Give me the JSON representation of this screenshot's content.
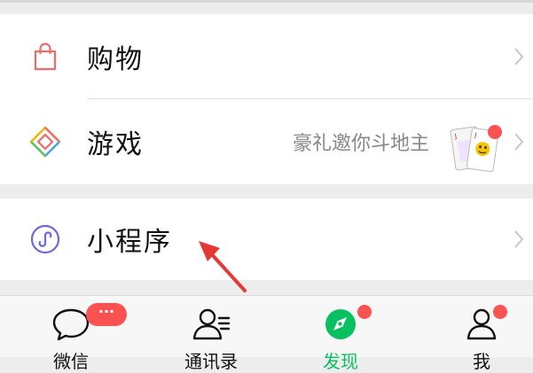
{
  "discover_list": {
    "shopping": {
      "label": "购物",
      "icon": "shopping-bag-icon"
    },
    "games": {
      "label": "游戏",
      "icon": "games-diamond-icon",
      "hint": "豪礼邀你斗地主",
      "thumbnail": "playing-cards-icon"
    },
    "mini_programs": {
      "label": "小程序",
      "icon": "mini-program-icon"
    }
  },
  "tab_bar": {
    "tabs": [
      {
        "label": "微信",
        "icon": "chat-bubble-icon",
        "badge": "···"
      },
      {
        "label": "通讯录",
        "icon": "contacts-icon"
      },
      {
        "label": "发现",
        "icon": "compass-icon",
        "active": true
      },
      {
        "label": "我",
        "icon": "profile-icon"
      }
    ]
  },
  "colors": {
    "accent_green": "#07c160",
    "badge_red": "#fa5151",
    "arrow_red": "#e53935",
    "background": "#ededed"
  }
}
